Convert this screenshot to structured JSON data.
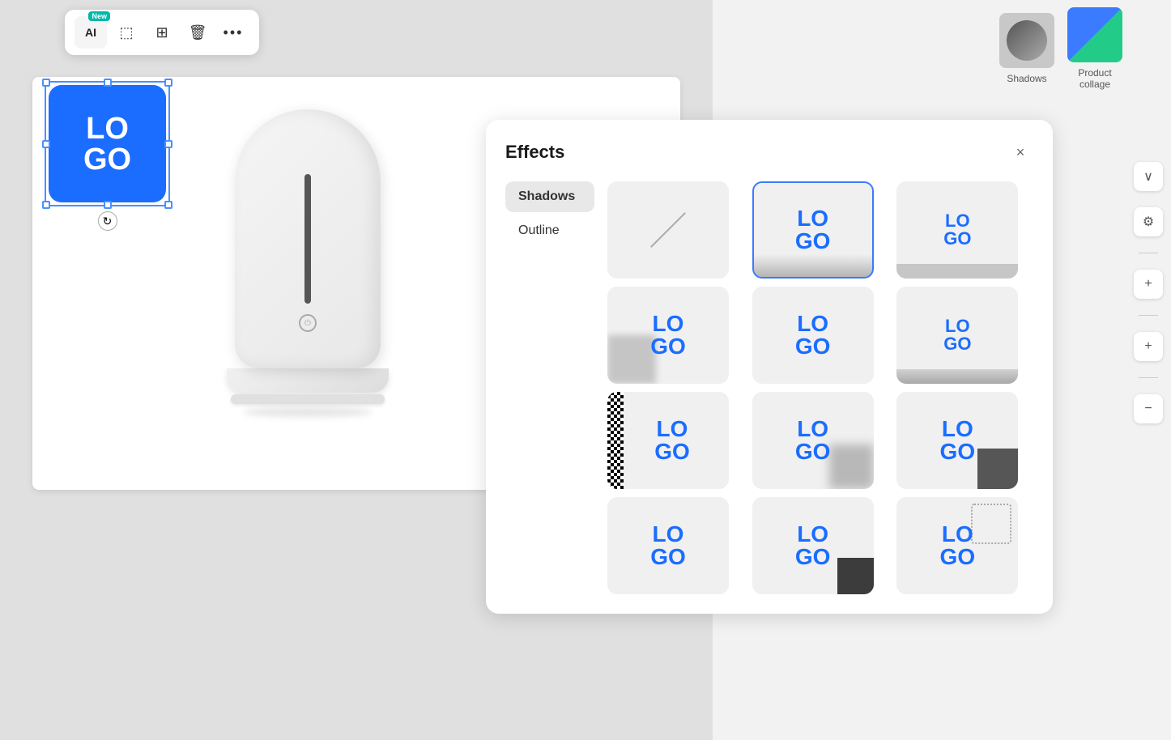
{
  "toolbar": {
    "ai_label": "AI",
    "ai_badge": "New",
    "icons": [
      "⬚",
      "⊞",
      "🗑",
      "···"
    ],
    "icon_names": [
      "select-icon",
      "add-frame-icon",
      "delete-icon",
      "more-icon"
    ]
  },
  "template_bar": {
    "items": [
      {
        "label": "Shadows",
        "type": "shadows"
      },
      {
        "label": "Product\ncollage",
        "type": "product-collage"
      }
    ]
  },
  "effects_panel": {
    "title": "Effects",
    "close_icon": "×",
    "nav_items": [
      {
        "label": "Shadows",
        "active": true
      },
      {
        "label": "Outline",
        "active": false
      }
    ],
    "grid": [
      {
        "type": "none",
        "selected": false
      },
      {
        "type": "shadow-bottom-soft",
        "selected": true
      },
      {
        "type": "shadow-bottom-tight",
        "selected": false
      },
      {
        "type": "shadow-corner-bl",
        "selected": false
      },
      {
        "type": "shadow-center",
        "selected": false
      },
      {
        "type": "shadow-bottom-hard",
        "selected": false
      },
      {
        "type": "checker-left",
        "selected": false
      },
      {
        "type": "shadow-corner-br",
        "selected": false
      },
      {
        "type": "dark-bottom-right",
        "selected": false
      },
      {
        "type": "unknown1",
        "selected": false
      },
      {
        "type": "unknown2",
        "selected": false
      },
      {
        "type": "dotted-outline",
        "selected": false
      }
    ]
  },
  "edge_controls": {
    "filter_icon": "⚙",
    "plus_icon_1": "+",
    "plus_icon_2": "+",
    "minus_icon": "−",
    "chevron_down": "∨"
  },
  "canvas": {
    "logo_text_line1": "LO",
    "logo_text_line2": "GO"
  }
}
